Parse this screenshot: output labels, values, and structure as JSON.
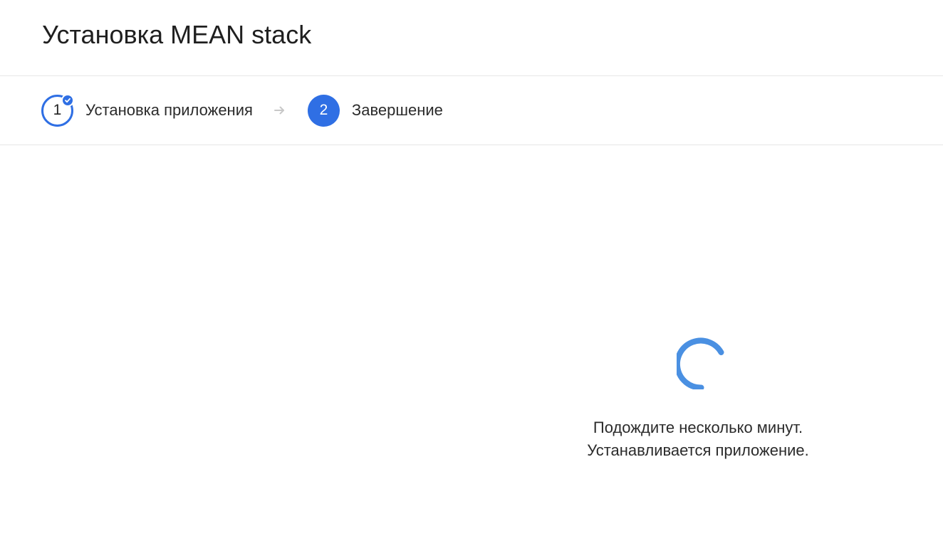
{
  "header": {
    "title": "Установка MEAN stack"
  },
  "stepper": {
    "steps": [
      {
        "number": "1",
        "label": "Установка приложения",
        "state": "completed"
      },
      {
        "number": "2",
        "label": "Завершение",
        "state": "active"
      }
    ],
    "arrow_icon": "arrow-right-icon",
    "check_icon": "check-icon"
  },
  "status": {
    "line1": "Подождите несколько минут.",
    "line2": "Устанавливается приложение.",
    "spinner_icon": "spinner-icon"
  },
  "colors": {
    "accent": "#2f6fe4",
    "spinner": "#4a90e2",
    "divider": "#e6e6e6",
    "arrow": "#c8c8c8"
  }
}
